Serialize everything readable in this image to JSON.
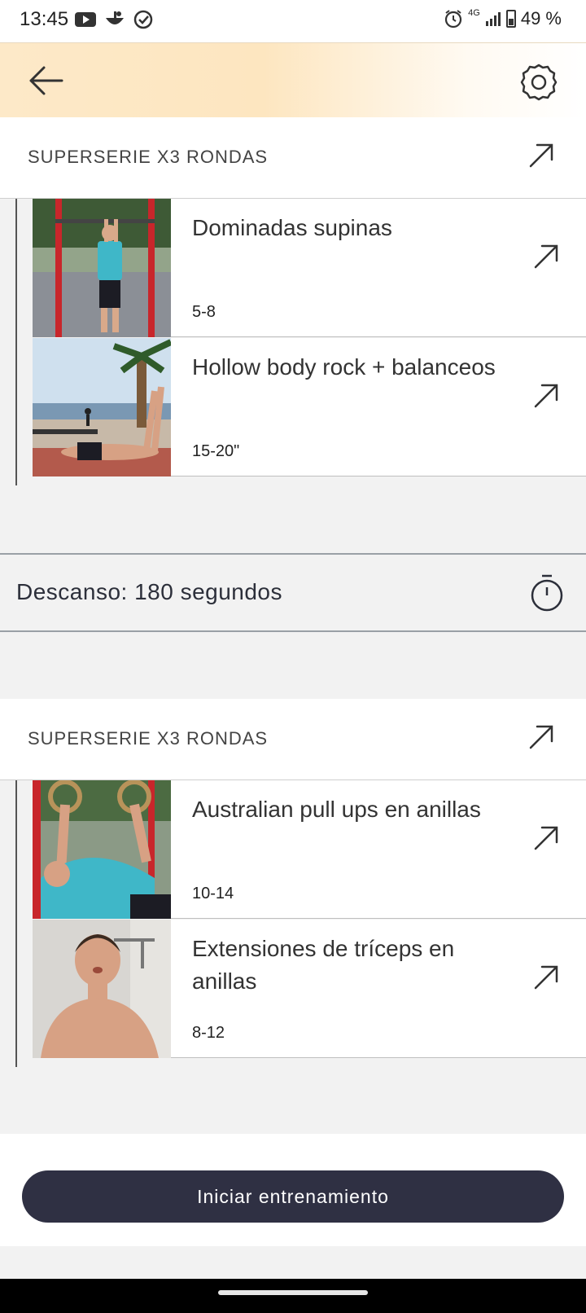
{
  "status_bar": {
    "time": "13:45",
    "network": "4G",
    "battery": "49 %",
    "icons": [
      "youtube-icon",
      "chef-hat-icon",
      "check-circle-icon",
      "alarm-icon",
      "signal-icon",
      "battery-icon"
    ]
  },
  "header": {
    "back_icon": "arrow-left-icon",
    "settings_icon": "gear-icon"
  },
  "sections": [
    {
      "title": "SUPERSERIE X3 RONDAS",
      "exercises": [
        {
          "name": "Dominadas supinas",
          "reps": "5-8"
        },
        {
          "name": "Hollow body rock + balanceos",
          "reps": "15-20\""
        }
      ]
    },
    {
      "title": "SUPERSERIE X3 RONDAS",
      "exercises": [
        {
          "name": "Australian pull ups en anillas",
          "reps": "10-14"
        },
        {
          "name": "Extensiones de tríceps en anillas",
          "reps": "8-12"
        }
      ]
    }
  ],
  "rest": {
    "label": "Descanso: 180 segundos",
    "icon": "stopwatch-icon"
  },
  "start_button": {
    "label": "Iniciar entrenamiento"
  },
  "colors": {
    "accent_dark": "#2f3043",
    "header_gradient": "#fde6c0"
  }
}
